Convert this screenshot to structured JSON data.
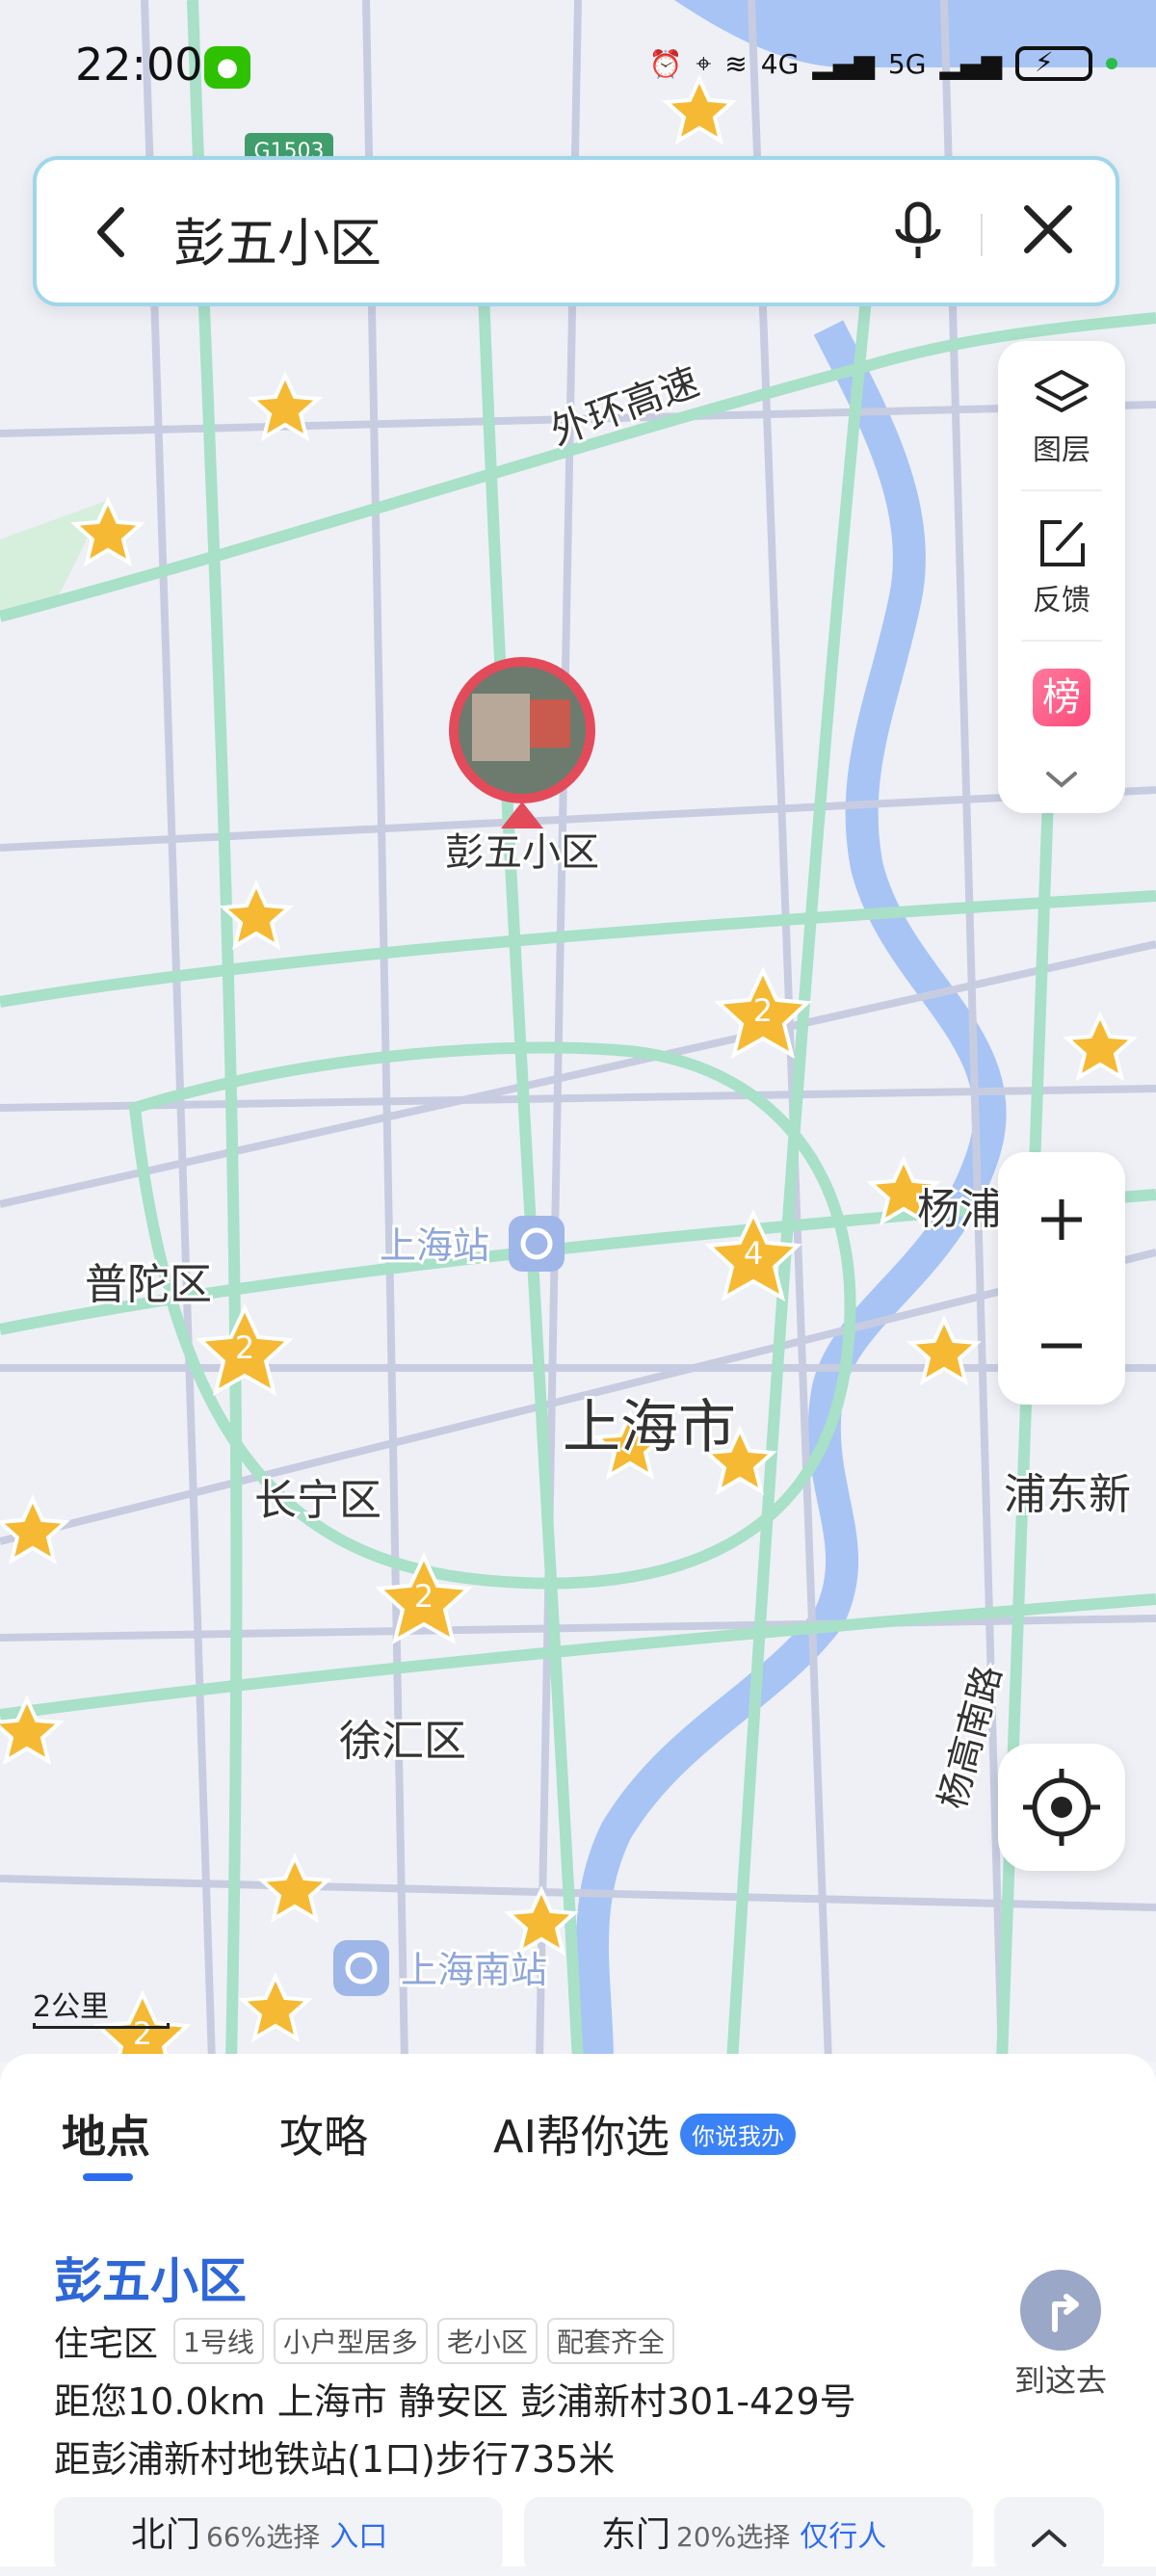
{
  "status_bar": {
    "time": "22:00",
    "net1": "4G",
    "net2": "5G"
  },
  "search": {
    "query": "彭五小区"
  },
  "map": {
    "pin_label": "彭五小区",
    "labels": {
      "ring_road": "外环高速",
      "shanghai_station": "上海站",
      "putuo": "普陀区",
      "changning": "长宁区",
      "xuhui": "徐汇区",
      "shanghai_city": "上海市",
      "yangpu": "杨浦",
      "pudong": "浦东新",
      "yanggao_road": "杨高南路",
      "shanghai_south": "上海南站",
      "highway_sign": "G1503"
    },
    "star_counts": [
      "2",
      "4",
      "2",
      "2",
      "2"
    ],
    "scale": "2公里"
  },
  "map_tools": {
    "layers": "图层",
    "feedback": "反馈",
    "rank_icon_text": "榜"
  },
  "panel": {
    "tabs": [
      {
        "label": "地点"
      },
      {
        "label": "攻略"
      },
      {
        "label": "AI帮你选"
      }
    ],
    "ai_badge": "你说我办",
    "poi": {
      "name": "彭五小区",
      "type": "住宅区",
      "tags": [
        "1号线",
        "小户型居多",
        "老小区",
        "配套齐全"
      ],
      "address": "距您10.0km 上海市 静安区 彭浦新村301-429号",
      "metro": "距彭浦新村地铁站(1口)步行735米",
      "go_label": "到这去"
    },
    "gates": [
      {
        "name": "北门",
        "pct": "66%选择",
        "entry": "入口"
      },
      {
        "name": "东门",
        "pct": "20%选择",
        "entry": "仅行人"
      }
    ]
  }
}
